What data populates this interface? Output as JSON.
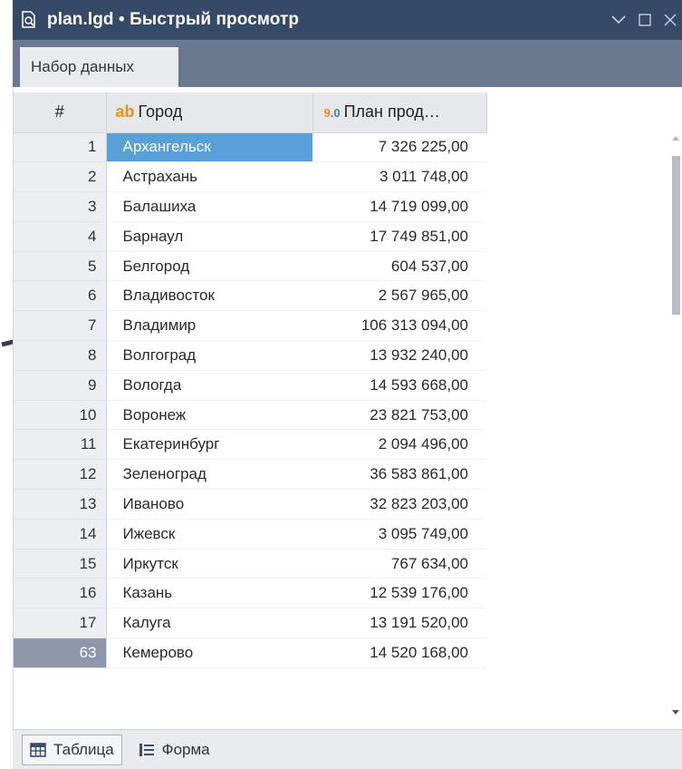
{
  "window": {
    "title": "plan.lgd • Быстрый просмотр"
  },
  "tabs": [
    {
      "label": "Набор данных",
      "active": true
    }
  ],
  "table": {
    "index_header": "#",
    "columns": [
      {
        "type_icon": "ab",
        "label": "Город"
      },
      {
        "type_icon": "9.0",
        "label": "План прод…"
      }
    ],
    "rows": [
      {
        "index": "1",
        "city": "Архангельск",
        "plan": "7 326 225,00",
        "selected": true
      },
      {
        "index": "2",
        "city": "Астрахань",
        "plan": "3 011 748,00"
      },
      {
        "index": "3",
        "city": "Балашиха",
        "plan": "14 719 099,00"
      },
      {
        "index": "4",
        "city": "Барнаул",
        "plan": "17 749 851,00"
      },
      {
        "index": "5",
        "city": "Белгород",
        "plan": "604 537,00"
      },
      {
        "index": "6",
        "city": "Владивосток",
        "plan": "2 567 965,00"
      },
      {
        "index": "7",
        "city": "Владимир",
        "plan": "106 313 094,00"
      },
      {
        "index": "8",
        "city": "Волгоград",
        "plan": "13 932 240,00"
      },
      {
        "index": "9",
        "city": "Вологда",
        "plan": "14 593 668,00"
      },
      {
        "index": "10",
        "city": "Воронеж",
        "plan": "23 821 753,00"
      },
      {
        "index": "11",
        "city": "Екатеринбург",
        "plan": "2 094 496,00"
      },
      {
        "index": "12",
        "city": "Зеленоград",
        "plan": "36 583 861,00"
      },
      {
        "index": "13",
        "city": "Иваново",
        "plan": "32 823 203,00"
      },
      {
        "index": "14",
        "city": "Ижевск",
        "plan": "3 095 749,00"
      },
      {
        "index": "15",
        "city": "Иркутск",
        "plan": "767 634,00"
      },
      {
        "index": "16",
        "city": "Казань",
        "plan": "12 539 176,00"
      },
      {
        "index": "17",
        "city": "Калуга",
        "plan": "13 191 520,00"
      },
      {
        "index": "63",
        "city": "Кемерово",
        "plan": "14 520 168,00",
        "current": true
      }
    ]
  },
  "bottom_tabs": [
    {
      "label": "Таблица",
      "icon": "table-icon",
      "active": true
    },
    {
      "label": "Форма",
      "icon": "form-icon",
      "active": false
    }
  ],
  "colors": {
    "titlebar": "#344a66",
    "tabbar": "#6a7890",
    "selection": "#5aa0d8",
    "current_row_index": "#8e97aa",
    "type_icon": "#e8940e"
  }
}
